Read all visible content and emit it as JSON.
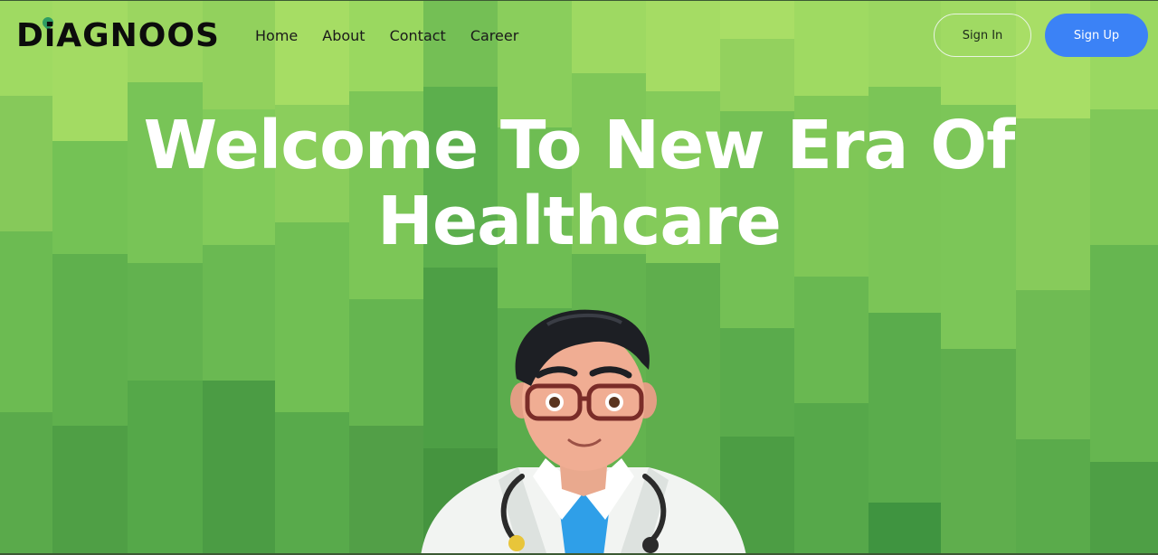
{
  "brand": {
    "name": "DiAGNOOS"
  },
  "nav": {
    "links": [
      "Home",
      "About",
      "Contact",
      "Career"
    ]
  },
  "auth": {
    "sign_in": "Sign In",
    "sign_up": "Sign Up"
  },
  "hero": {
    "title_line1": "Welcome To New Era Of",
    "title_line2": "Healthcare"
  },
  "colors": {
    "accent": "#3b82f6",
    "background": "#6cbd52",
    "title": "#ffffff",
    "logo_mark": "#2e9d63"
  },
  "illustration": {
    "icon": "doctor-avatar-illustration"
  }
}
